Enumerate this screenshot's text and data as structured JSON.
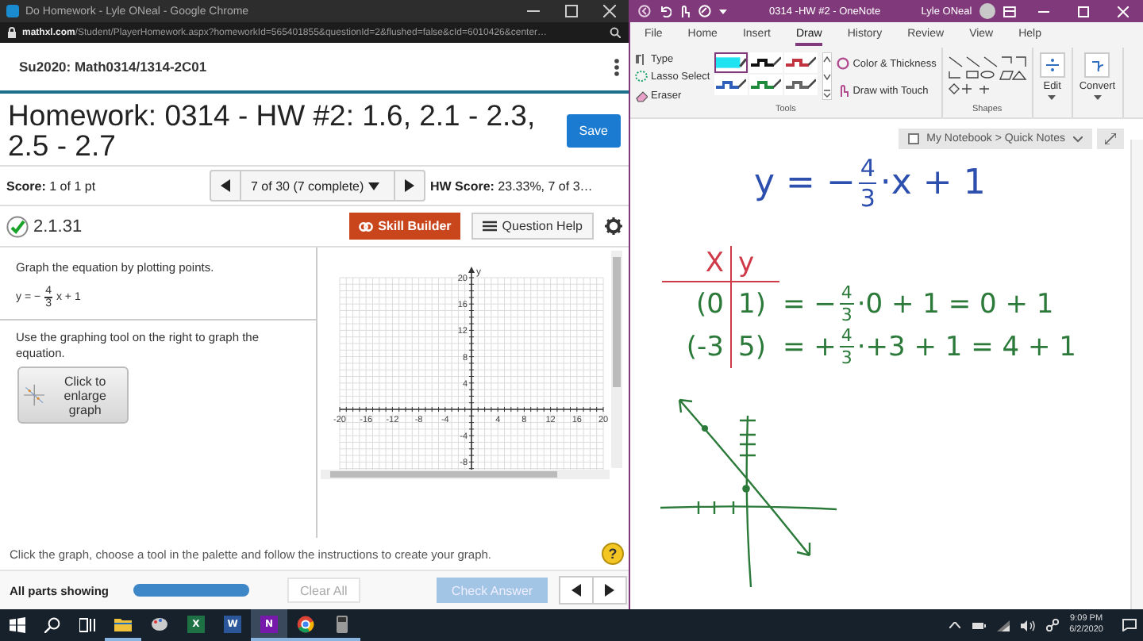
{
  "browser": {
    "title": "Do Homework - Lyle ONeal - Google Chrome",
    "url": "**mathxl.com**/Student/PlayerHomework.aspx?homeworkId=565401855&questionId=2&flushed=false&cId=6010426&center…",
    "course": "Su2020: Math0314/1314-2C01",
    "heading": "Homework: 0314 - HW #2: 1.6, 2.1 - 2.3, 2.5 - 2.7",
    "save": "Save",
    "score": "**Score:** 1 of 1 pt",
    "question_nav": "7 of 30 (7 complete)",
    "hw_score": "**HW Score:** 23.33%, 7 of 3…",
    "question": {
      "correct": true,
      "number": "2.1.31"
    },
    "skill_builder": "Skill Builder",
    "question_help": "Question Help",
    "prompt": "Graph the equation by plotting points.",
    "equation": {
      "lhs": "y = −",
      "numerator": "4",
      "denominator": "3",
      "rhs": "x + 1"
    },
    "instruction": "Use the graphing tool on the right to graph the equation.",
    "enlarge": "Click to enlarge graph",
    "graph": {
      "axis_label": "y",
      "x_ticks": [
        "-20",
        "-16",
        "-12",
        "-8",
        "-4",
        "4",
        "8",
        "12",
        "16",
        "20"
      ],
      "y_ticks": [
        "20",
        "16",
        "12",
        "8",
        "4",
        "-4",
        "-8"
      ]
    },
    "hint": "Click the graph, choose a tool in the palette and follow the instructions to create your graph.",
    "help": "?",
    "parts": {
      "label": "All parts showing",
      "level": 1
    },
    "clear_all": {
      "label": "Clear All",
      "disabled": true
    },
    "check_answer": {
      "label": "Check Answer",
      "disabled": true
    }
  },
  "onenote": {
    "title": "0314 -HW #2 - OneNote",
    "user": "Lyle ONeal",
    "tabs": [
      {
        "label": "File",
        "selected": false
      },
      {
        "label": "Home",
        "selected": false
      },
      {
        "label": "Insert",
        "selected": false
      },
      {
        "label": "Draw",
        "selected": true
      },
      {
        "label": "History",
        "selected": false
      },
      {
        "label": "Review",
        "selected": false
      },
      {
        "label": "View",
        "selected": false
      },
      {
        "label": "Help",
        "selected": false
      }
    ],
    "tools": [
      {
        "kind": "type",
        "label": "Type"
      },
      {
        "kind": "lasso",
        "label": "Lasso Select"
      },
      {
        "kind": "eraser",
        "label": "Eraser"
      }
    ],
    "pens": [
      {
        "kind": "highlighter",
        "color": "#1fe3f0",
        "selected": true
      },
      {
        "kind": "pen",
        "color": "#111111",
        "selected": false
      },
      {
        "kind": "pen",
        "color": "#c0333f",
        "selected": false
      },
      {
        "kind": "pen",
        "color": "#2f5fb8",
        "selected": false
      },
      {
        "kind": "pen",
        "color": "#1f8a3c",
        "selected": false
      },
      {
        "kind": "pen",
        "color": "#666666",
        "selected": false
      }
    ],
    "pen_options": [
      {
        "kind": "color",
        "label": "Color & Thickness"
      },
      {
        "kind": "touch",
        "label": "Draw with Touch"
      }
    ],
    "tools_group": "Tools",
    "shapes_group": "Shapes",
    "edit": "Edit",
    "convert": "Convert",
    "breadcrumb": "My Notebook > Quick Notes",
    "ink": {
      "equation": {
        "lhs": "y = −",
        "numerator": "4",
        "denominator": "3",
        "rhs": "·x + 1"
      },
      "headers": [
        "X",
        "y"
      ],
      "rows": [
        {
          "x": "(0",
          "y": "1)",
          "before": "= −",
          "numerator": "4",
          "denominator": "3",
          "after": "·0 + 1 = 0 + 1"
        },
        {
          "x": "(-3",
          "y": "5)",
          "before": "= +",
          "numerator": "4",
          "denominator": "3",
          "after": "·+3 + 1 = 4 + 1"
        }
      ]
    }
  },
  "taskbar": {
    "apps": [
      {
        "kind": "explorer",
        "running": true,
        "selected": false
      },
      {
        "kind": "paint",
        "running": false,
        "selected": false
      },
      {
        "kind": "excel",
        "letter": "X",
        "running": false,
        "selected": false
      },
      {
        "kind": "word",
        "letter": "W",
        "running": false,
        "selected": false
      },
      {
        "kind": "onenote",
        "letter": "N",
        "running": true,
        "selected": true
      },
      {
        "kind": "chrome",
        "running": true,
        "selected": false
      },
      {
        "kind": "calculator",
        "running": true,
        "selected": false
      }
    ],
    "time": "9:09 PM",
    "date": "6/2/2020"
  }
}
